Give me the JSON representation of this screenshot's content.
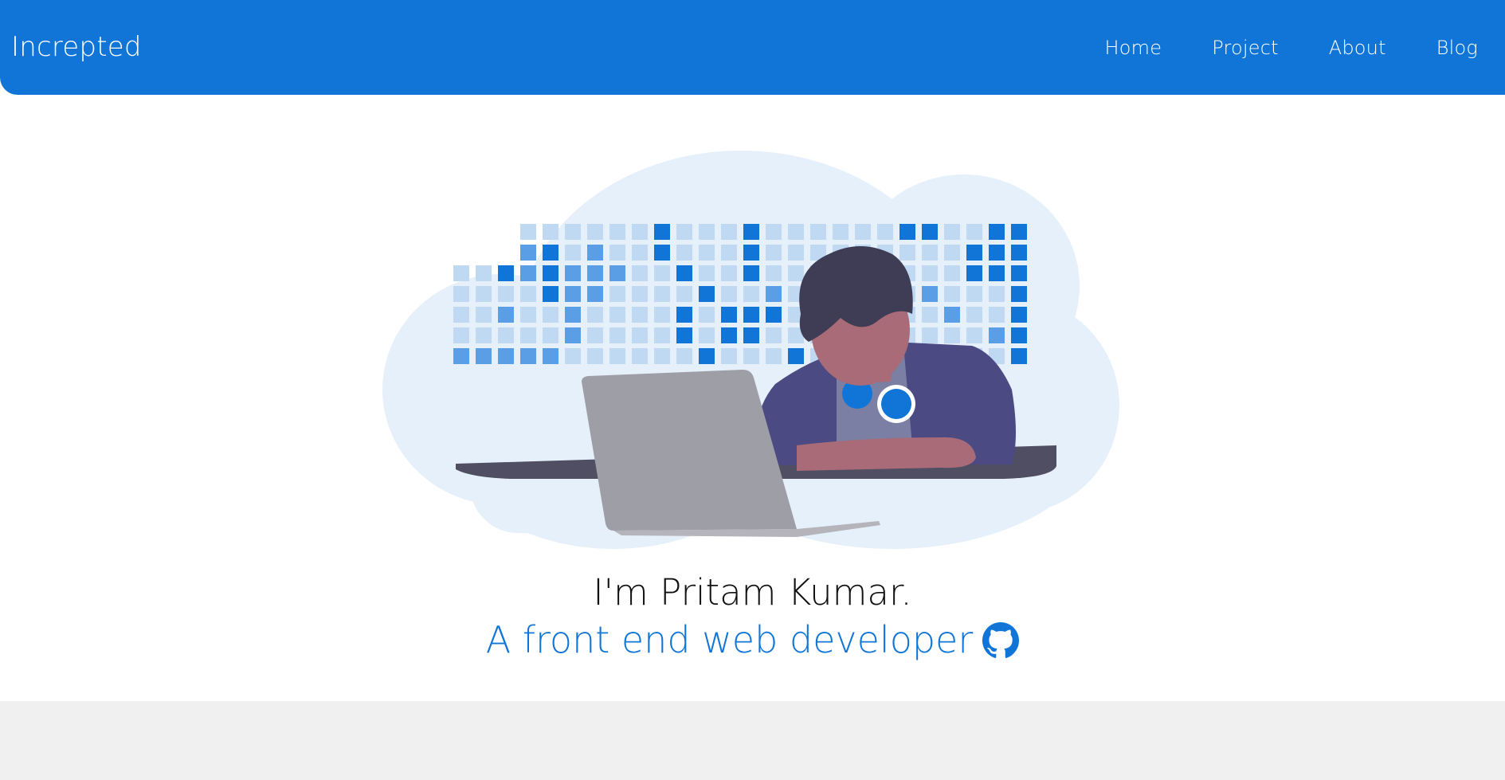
{
  "colors": {
    "primary": "#1075d6",
    "background": "#ffffff",
    "footer": "#f0f0f0",
    "cloud": "#e6f0fa"
  },
  "nav": {
    "brand": "Increpted",
    "links": [
      {
        "label": "Home"
      },
      {
        "label": "Project"
      },
      {
        "label": "About"
      },
      {
        "label": "Blog"
      }
    ]
  },
  "hero": {
    "headline": "I'm Pritam Kumar.",
    "subline": "A front end web developer",
    "github_icon": "github-icon",
    "illustration": "developer-at-laptop-illustration"
  }
}
